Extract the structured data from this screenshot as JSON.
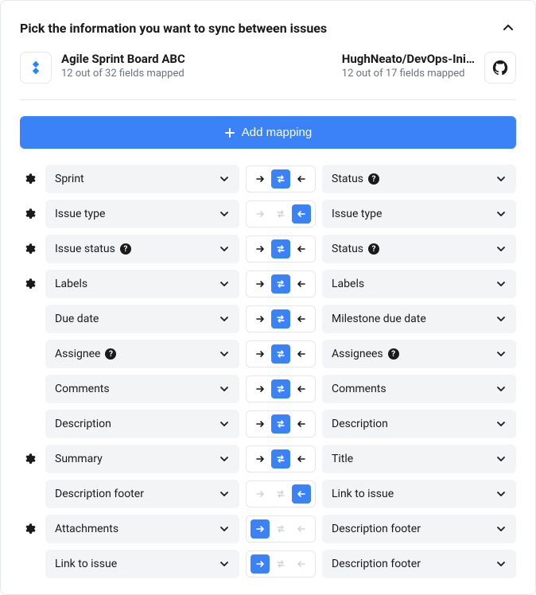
{
  "header": {
    "title": "Pick the information you want to sync between issues"
  },
  "left_conn": {
    "name": "Agile Sprint Board ABC",
    "sub": "12 out of 32 fields mapped"
  },
  "right_conn": {
    "name": "HughNeato/DevOps-Ini…",
    "sub": "12 out of 17 fields mapped"
  },
  "add_label": "Add mapping",
  "rows": [
    {
      "gear": true,
      "left": "Sprint",
      "lh": false,
      "right": "Status",
      "rh": true,
      "dir": "both"
    },
    {
      "gear": true,
      "left": "Issue type",
      "lh": false,
      "right": "Issue type",
      "rh": false,
      "dir": "right-to-left"
    },
    {
      "gear": true,
      "left": "Issue status",
      "lh": true,
      "right": "Status",
      "rh": true,
      "dir": "both"
    },
    {
      "gear": true,
      "left": "Labels",
      "lh": false,
      "right": "Labels",
      "rh": false,
      "dir": "both"
    },
    {
      "gear": false,
      "left": "Due date",
      "lh": false,
      "right": "Milestone due date",
      "rh": false,
      "dir": "both"
    },
    {
      "gear": false,
      "left": "Assignee",
      "lh": true,
      "right": "Assignees",
      "rh": true,
      "dir": "both"
    },
    {
      "gear": false,
      "left": "Comments",
      "lh": false,
      "right": "Comments",
      "rh": false,
      "dir": "both"
    },
    {
      "gear": false,
      "left": "Description",
      "lh": false,
      "right": "Description",
      "rh": false,
      "dir": "both"
    },
    {
      "gear": true,
      "left": "Summary",
      "lh": false,
      "right": "Title",
      "rh": false,
      "dir": "both"
    },
    {
      "gear": false,
      "left": "Description footer",
      "lh": false,
      "right": "Link to issue",
      "rh": false,
      "dir": "right-to-left"
    },
    {
      "gear": true,
      "left": "Attachments",
      "lh": false,
      "right": "Description footer",
      "rh": false,
      "dir": "left-to-right"
    },
    {
      "gear": false,
      "left": "Link to issue",
      "lh": false,
      "right": "Description footer",
      "rh": false,
      "dir": "left-to-right"
    }
  ]
}
